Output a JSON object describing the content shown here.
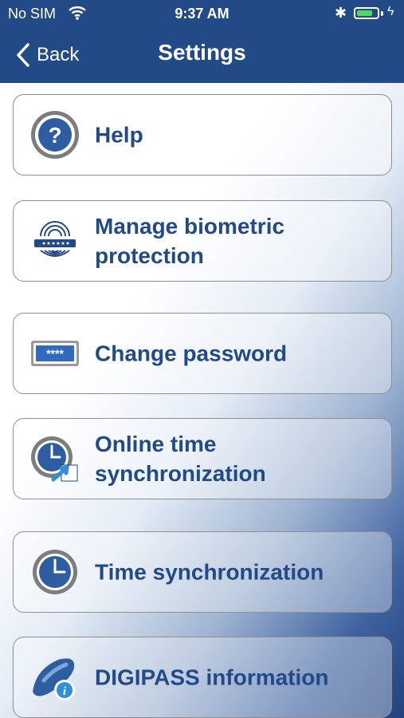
{
  "status_bar": {
    "carrier": "No SIM",
    "time": "9:37 AM",
    "bluetooth_icon": "bluetooth-icon",
    "battery_level": 0.8
  },
  "nav": {
    "back_label": "Back",
    "title": "Settings"
  },
  "items": [
    {
      "label": "Help",
      "icon": "help-icon"
    },
    {
      "label": "Manage biometric protection",
      "icon": "fingerprint-icon"
    },
    {
      "label": "Change password",
      "icon": "password-field-icon"
    },
    {
      "label": "Online time synchronization",
      "icon": "online-clock-sync-icon"
    },
    {
      "label": "Time synchronization",
      "icon": "clock-icon"
    },
    {
      "label": "DIGIPASS information",
      "icon": "digipass-info-icon"
    }
  ],
  "colors": {
    "bar": "#214a86",
    "label": "#214a86"
  }
}
